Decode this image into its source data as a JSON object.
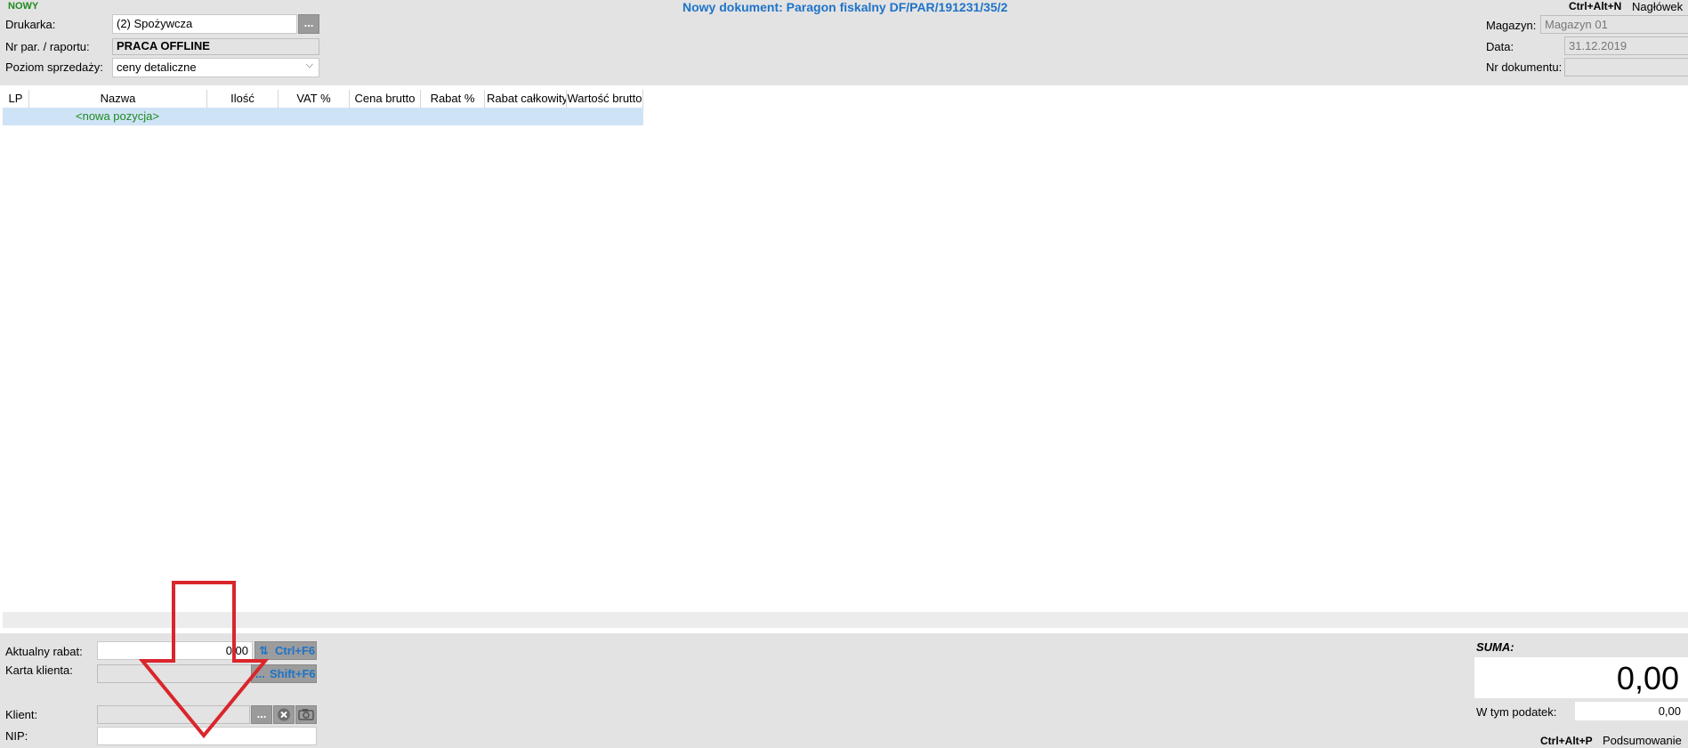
{
  "header": {
    "status_badge": "NOWY",
    "document_title": "Nowy dokument: Paragon fiskalny DF/PAR/191231/35/2",
    "hotkey_header": "Ctrl+Alt+N",
    "hotkey_header_label": "Nagłówek",
    "printer_label": "Drukarka:",
    "printer_value": "(2) Spożywcza",
    "printer_browse": "...",
    "report_label": "Nr par. / raportu:",
    "report_value": "PRACA OFFLINE",
    "price_level_label": "Poziom sprzedaży:",
    "price_level_value": "ceny detaliczne",
    "warehouse_label": "Magazyn:",
    "warehouse_value": "Magazyn 01",
    "date_label": "Data:",
    "date_value": "31.12.2019",
    "doc_number_label": "Nr dokumentu:",
    "doc_number_value": ""
  },
  "grid": {
    "columns": [
      "LP",
      "Nazwa",
      "Ilość",
      "VAT %",
      "Cena brutto",
      "Rabat %",
      "Rabat całkowity",
      "Wartość brutto"
    ],
    "new_row_label": "<nowa pozycja>"
  },
  "footer": {
    "discount_label": "Aktualny rabat:",
    "discount_value": "0,00",
    "discount_hotkey": "Ctrl+F6",
    "card_label": "Karta klienta:",
    "card_value": "",
    "card_hotkey": "Shift+F6",
    "client_label": "Klient:",
    "client_value": "",
    "client_browse": "...",
    "nip_label": "NIP:",
    "nip_value": "",
    "sum_label": "SUMA:",
    "sum_value": "0,00",
    "tax_label": "W tym podatek:",
    "tax_value": "0,00",
    "hotkey_summary": "Ctrl+Alt+P",
    "hotkey_summary_label": "Podsumowanie"
  },
  "colors": {
    "accent_blue": "#1e73c8",
    "status_green": "#1f8a1f",
    "annotation_red": "#d9262c",
    "panel_gray": "#e3e3e3",
    "row_highlight": "#cfe3f6"
  },
  "icons": [
    "browse-dots-icon",
    "chevron-down-icon",
    "swap-icon",
    "clear-icon",
    "camera-icon",
    "down-arrow-annotation"
  ]
}
